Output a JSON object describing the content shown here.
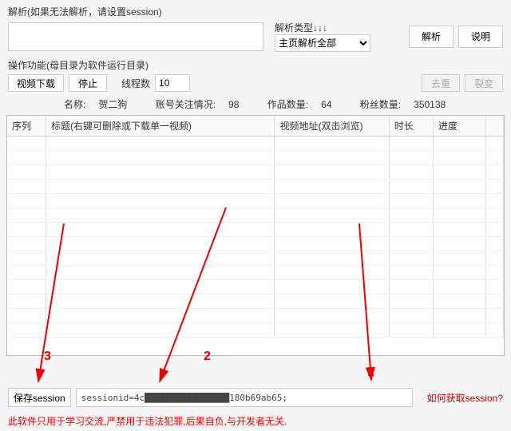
{
  "parse": {
    "label": "解析(如果无法解析，请设置session)",
    "input_value": "",
    "type_label": "解析类型↓↓↓",
    "type_selected": "主页解析全部",
    "parse_btn": "解析",
    "help_btn": "说明"
  },
  "ops": {
    "label": "操作功能(母目录为软件运行目录)",
    "download_btn": "视频下载",
    "stop_btn": "停止",
    "thread_label": "线程数",
    "thread_value": "10",
    "dedup_btn": "去重",
    "split_btn": "裂变"
  },
  "info": {
    "name_label": "名称:",
    "name_value": "贺二狗",
    "follow_label": "账号关注情况:",
    "follow_value": "98",
    "works_label": "作品数量:",
    "works_value": "64",
    "fans_label": "粉丝数量:",
    "fans_value": "350138"
  },
  "table": {
    "headers": {
      "seq": "序列",
      "title": "标题(右键可删除或下载单一视频)",
      "url": "视频地址(双击浏览)",
      "dur": "时长",
      "prog": "进度"
    },
    "rows": []
  },
  "bottom": {
    "save_btn": "保存session",
    "session_value": "sessionid=4c████████████████180b69ab65;",
    "how_link": "如何获取session?"
  },
  "disclaimer": "此软件只用于学习交流,严禁用于违法犯罪,后果自负,与开发者无关.",
  "anno": {
    "n1": "1",
    "n2": "2",
    "n3": "3"
  }
}
